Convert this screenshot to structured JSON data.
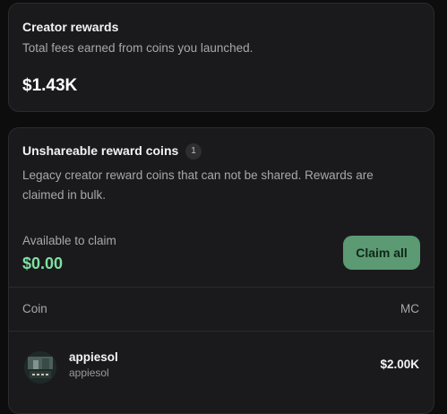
{
  "creator_rewards": {
    "title": "Creator rewards",
    "subtitle": "Total fees earned from coins you launched.",
    "total": "$1.43K"
  },
  "unshareable": {
    "title": "Unshareable reward coins",
    "count": "1",
    "description_line1": "Legacy creator reward coins that can not be shared. Rewards are",
    "description_line2": "claimed in bulk.",
    "available_label": "Available to claim",
    "available_value": "$0.00",
    "claim_button": "Claim all",
    "table": {
      "columns": [
        "Coin",
        "MC"
      ],
      "rows": [
        {
          "name": "appiesol",
          "ticker": "appiesol",
          "mc": "$2.00K"
        }
      ]
    }
  },
  "colors": {
    "background": "#0d0d0e",
    "card": "#1a1a1c",
    "accent_green": "#7ee0a0",
    "button_green": "#5b9a72"
  }
}
